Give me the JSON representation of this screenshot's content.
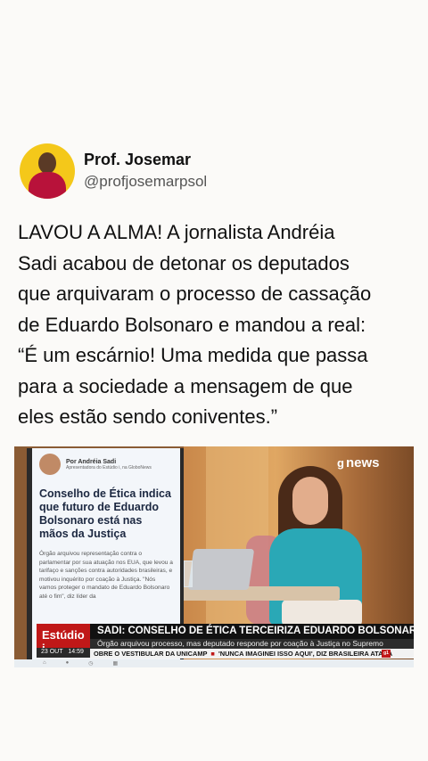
{
  "author": {
    "display_name": "Prof. Josemar",
    "handle": "@profjosemarpsol"
  },
  "tweet": {
    "lines": [
      "LAVOU A ALMA! A jornalista Andréia",
      "Sadi acabou de detonar os deputados",
      "que arquivaram o processo de cassação",
      "de Eduardo Bolsonaro e mandou a real:",
      "“É um escárnio! Uma medida que passa",
      "para a sociedade a mensagem de que",
      "eles estão sendo coniventes.”"
    ]
  },
  "media": {
    "channel_logo": {
      "g": "g",
      "word": "news"
    },
    "screen": {
      "by_line": "Por Andréia Sadi",
      "by_sub": "Apresentadora do Estúdio i, na GloboNews",
      "headline": "Conselho de Ética indica que futuro de Eduardo Bolsonaro está nas mãos da Justiça",
      "body": "Órgão arquivou representação contra o parlamentar por sua atuação nos EUA, que levou a tarifaço e sanções contra autoridades brasileiras, e motivou inquérito por coação à Justiça. \"Nós vamos proteger o mandato de Eduardo Bolsonaro até o fim\", diz líder da"
    },
    "lower_third": {
      "program": "Estúdio i",
      "date": "23 OUT",
      "time": "14:59",
      "headline": "SADI: CONSELHO DE ÉTICA TERCEIRIZA EDUARDO BOLSONARO PARA O STF",
      "subheadline": "Órgão arquivou processo, mas deputado responde por coação à Justiça no Supremo",
      "ticker_items": [
        "OBRE O VESTIBULAR DA UNICAMP",
        "'NUNCA IMAGINEI ISSO AQUI', DIZ BRASILEIRA ATACA"
      ],
      "ticker_badge": "g1"
    }
  },
  "colors": {
    "program_red": "#c01818",
    "anchor_shirt": "#2aa8b6",
    "avatar_bg": "#f4c81a"
  }
}
